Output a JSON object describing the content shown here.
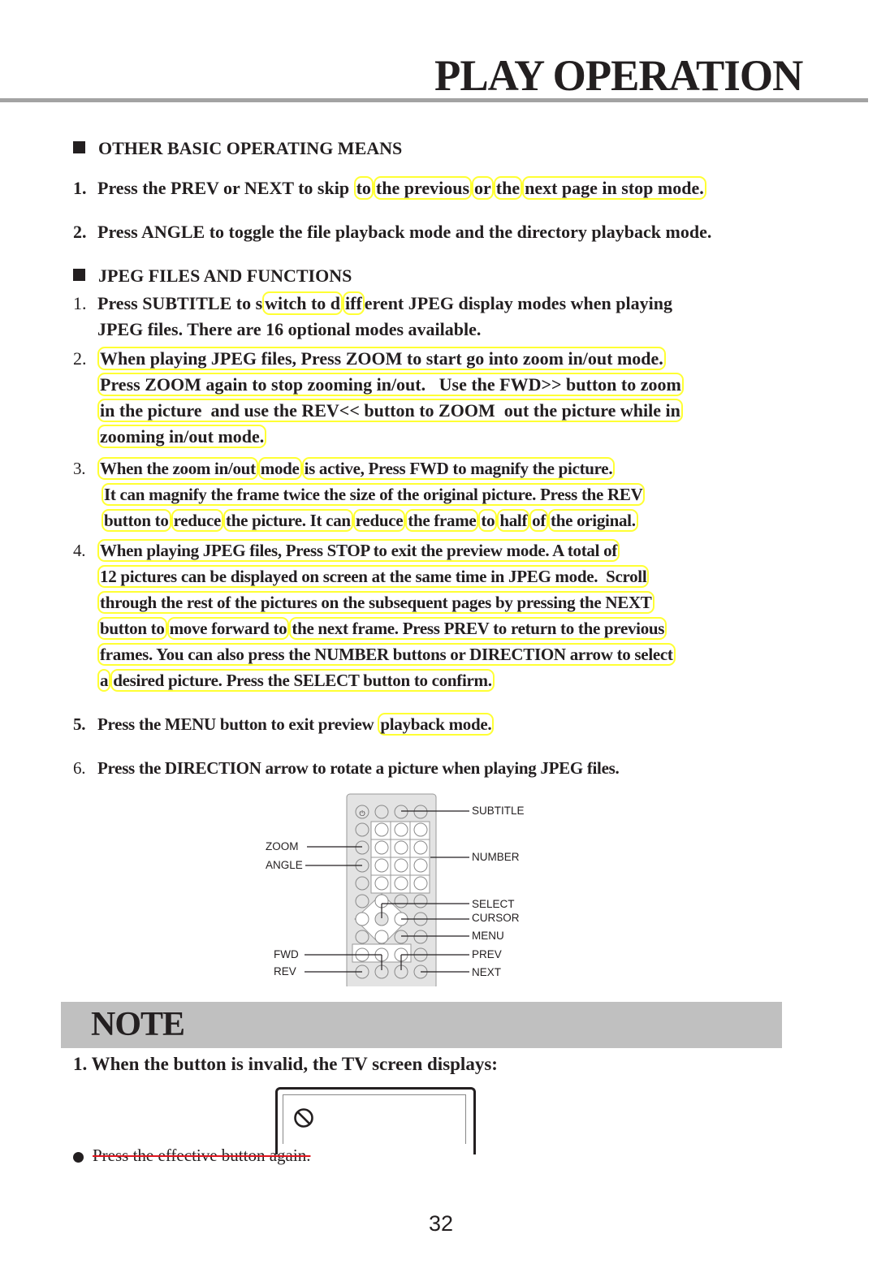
{
  "page": {
    "title": "PLAY OPERATION",
    "page_number": "32",
    "highlight_color": "#ffff33",
    "strike_color": "#e0141e"
  },
  "section1": {
    "heading": "OTHER BASIC OPERATING MEANS",
    "items": [
      {
        "number": "1.",
        "segments": [
          "Press the PREV or NEXT to skip ",
          "to",
          " ",
          "the previous",
          " ",
          "or",
          " ",
          "the",
          " ",
          "next page in stop mode."
        ]
      },
      {
        "number": "2.",
        "text": "Press ANGLE to toggle the file playback mode and the directory playback mode."
      }
    ]
  },
  "section2": {
    "heading": "JPEG FILES AND FUNCTIONS",
    "items": [
      {
        "number": "1.",
        "lines": [
          "Press SUBTITLE to s|witch to d|iff|erent JPEG display modes when playing",
          "JPEG files. There are 16 optional modes available."
        ],
        "line1_segments": [
          "Press SUBTITLE to s",
          "witch to d",
          "iff",
          "erent JPEG display modes when playing"
        ],
        "line2": "JPEG files. There are 16 optional modes available."
      },
      {
        "number": "2.",
        "lines": [
          "When playing JPEG files, Press ZOOM to start go into zoom in/out mode.",
          "Press ZOOM again to stop zooming in/out.   Use the FWD>> button to zoom",
          "in the picture  and use the REV<< button to ZOOM  out the picture while in",
          "zooming in/out mode."
        ]
      },
      {
        "number": "3.",
        "line1_segments": [
          "When the zoom in/out",
          "mode",
          "is active, Press FWD to magnify the picture."
        ],
        "line2": "It can magnify the frame twice the size of the original picture. Press the REV",
        "line3_segments": [
          "button to",
          "reduce",
          "the picture. It can",
          "reduce",
          "the frame",
          "to",
          "half",
          "of",
          "the original."
        ]
      },
      {
        "number": "4.",
        "line1": "When playing JPEG files, Press STOP to exit the preview mode. A total of",
        "line2": "12 pictures can be displayed on screen at the same time in JPEG mode.  Scroll",
        "line3": "through the rest of the pictures on the subsequent pages by pressing the NEXT",
        "line4_segments": [
          "button to",
          "move forward to",
          "the next frame. Press PREV to return to the previous"
        ],
        "line5": "frames. You can also press the NUMBER buttons or DIRECTION arrow to select",
        "line6_segments": [
          "a",
          "desired picture. Press the SELECT button to confirm."
        ]
      },
      {
        "number": "5.",
        "segments": [
          "Press the MENU button to exit preview ",
          "playback mode."
        ]
      },
      {
        "number": "6.",
        "text": "Press the DIRECTION arrow to rotate a picture when playing JPEG files."
      }
    ]
  },
  "remote": {
    "labels_left": [
      "ZOOM",
      "ANGLE",
      "FWD",
      "REV"
    ],
    "labels_right": [
      "SUBTITLE",
      "NUMBER",
      "SELECT",
      "CURSOR",
      "MENU",
      "PREV",
      "NEXT"
    ],
    "power_icon": "power-icon"
  },
  "note": {
    "title": "NOTE",
    "line": "1. When the button is invalid, the TV screen displays:",
    "screen_icon": "prohibited-icon",
    "bullet_text": "Press the effective button again."
  }
}
